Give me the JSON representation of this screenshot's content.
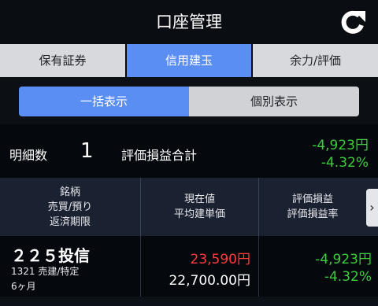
{
  "header": {
    "title": "口座管理",
    "refresh_icon": "refresh-icon"
  },
  "tabs": [
    {
      "label": "保有証券",
      "active": false
    },
    {
      "label": "信用建玉",
      "active": true
    },
    {
      "label": "余力/評価",
      "active": false
    }
  ],
  "subtabs": [
    {
      "label": "一括表示",
      "active": true
    },
    {
      "label": "個別表示",
      "active": false
    }
  ],
  "summary": {
    "count_label": "明細数",
    "count": "1",
    "total_label": "評価損益合計",
    "total_value": "-4,923円",
    "total_rate": "-4.32%"
  },
  "table": {
    "headers": {
      "col1": [
        "銘柄",
        "売買/預り",
        "返済期限"
      ],
      "col2": [
        "現在値",
        "平均建単価"
      ],
      "col3": [
        "評価損益",
        "評価損益率"
      ]
    },
    "next_icon": "chevron-right-icon",
    "rows": [
      {
        "name": "２２５投信",
        "code_type": "1321 売建/特定",
        "term": "6ヶ月",
        "current_price": "23,590円",
        "avg_price": "22,700.00円",
        "pl": "-4,923円",
        "pl_rate": "-4.32%"
      }
    ]
  },
  "colors": {
    "accent": "#5b8ef2",
    "positive": "#3ccd3c",
    "negative": "#ff3a3a"
  }
}
